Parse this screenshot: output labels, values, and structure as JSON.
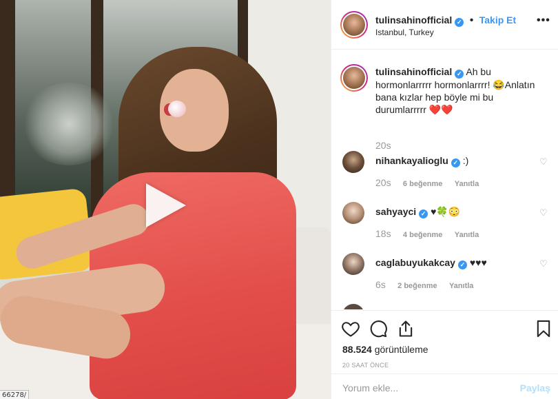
{
  "media": {
    "url_fragment": "66278/"
  },
  "header": {
    "username": "tulinsahinofficial",
    "verified_glyph": "✓",
    "separator": "•",
    "follow_label": "Takip Et",
    "location": "Istanbul, Turkey",
    "more_icon": "•••"
  },
  "caption": {
    "username": "tulinsahinofficial",
    "text": "Ah bu hormonlarrrrr hormonlarrrr! 😂Anlatın bana kızlar hep böyle mi bu durumlarrrrr ❤️❤️",
    "time": "20s"
  },
  "comments": [
    {
      "username": "nihankayalioglu",
      "text": ":)",
      "time": "20s",
      "likes": "6 beğenme",
      "reply": "Yanıtla"
    },
    {
      "username": "sahyayci",
      "text": "♥🍀😳",
      "time": "18s",
      "likes": "4 beğenme",
      "reply": "Yanıtla"
    },
    {
      "username": "caglabuyukakcay",
      "text": "♥♥♥",
      "time": "6s",
      "likes": "2 beğenme",
      "reply": "Yanıtla"
    }
  ],
  "stats": {
    "views_count": "88.524",
    "views_label": "görüntüleme",
    "posted_ago": "20 SAAT ÖNCE"
  },
  "add_comment": {
    "placeholder": "Yorum ekle...",
    "post_label": "Paylaş"
  },
  "colors": {
    "accent": "#3897f0",
    "text": "#262626",
    "muted": "#999999",
    "post_disabled": "#b2dffc"
  },
  "icons": {
    "like": "heart-icon",
    "comment": "comment-icon",
    "share": "share-icon",
    "save": "bookmark-icon",
    "play": "play-icon"
  }
}
